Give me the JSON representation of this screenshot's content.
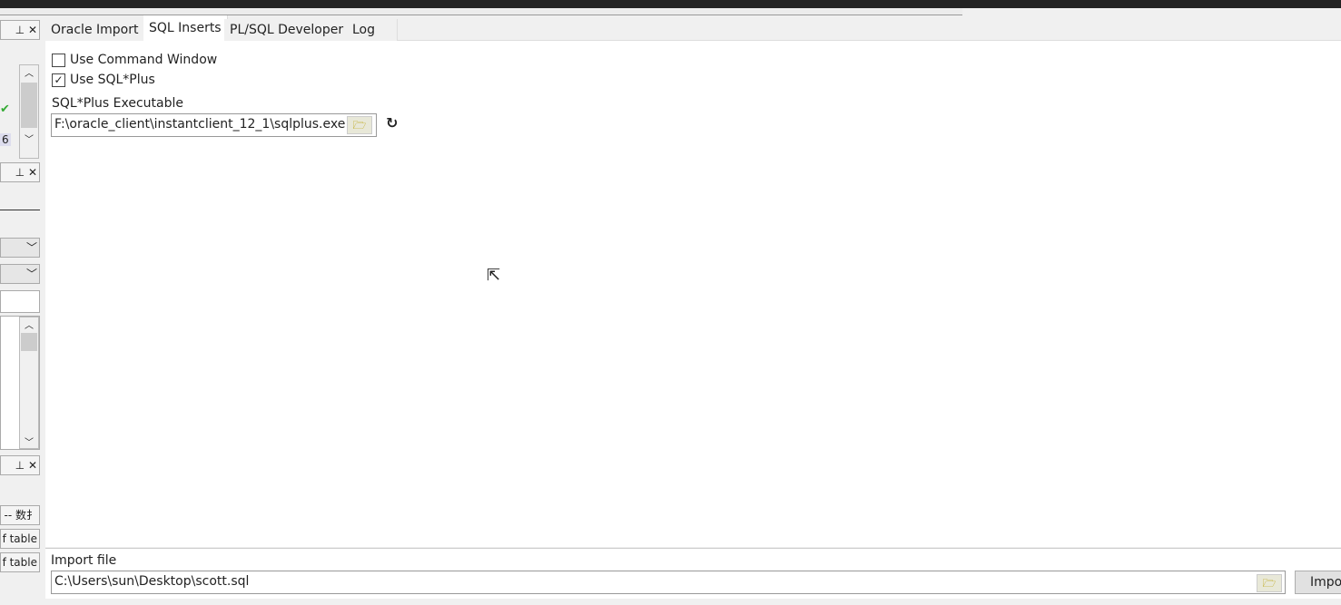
{
  "tabs": [
    {
      "label": "Oracle Import"
    },
    {
      "label": "SQL Inserts",
      "active": true
    },
    {
      "label": "PL/SQL Developer"
    },
    {
      "label": "Log"
    }
  ],
  "options": {
    "use_command_window": {
      "label": "Use Command Window",
      "checked": false
    },
    "use_sqlplus": {
      "label": "Use SQL*Plus",
      "checked": true
    }
  },
  "sqlplus": {
    "label": "SQL*Plus Executable",
    "value": "F:\\oracle_client\\instantclient_12_1\\sqlplus.exe"
  },
  "import_file": {
    "label": "Import file",
    "value": "C:\\Users\\sun\\Desktop\\scott.sql",
    "button": "Impo"
  },
  "left_panel": {
    "badge": "6",
    "rows": [
      "-- 数扌",
      "f table",
      "f table"
    ]
  },
  "icons": {
    "folder": "folder-open-icon",
    "refresh": "refresh-icon",
    "pin": "pin-icon",
    "close": "close-icon"
  }
}
